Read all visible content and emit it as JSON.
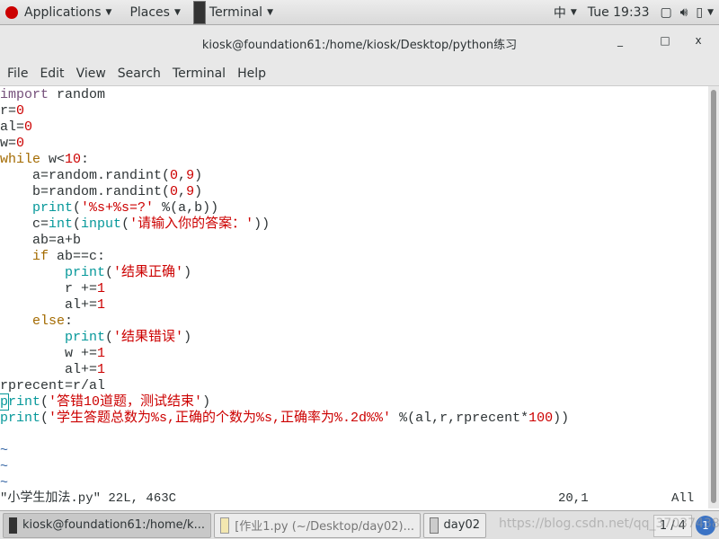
{
  "topbar": {
    "applications": "Applications",
    "places": "Places",
    "terminal": "Terminal",
    "input_method": "中",
    "clock": "Tue 19:33"
  },
  "window": {
    "title": "kiosk@foundation61:/home/kiosk/Desktop/python练习",
    "minimize": "_",
    "maximize": "□",
    "close": "x"
  },
  "menu": [
    "File",
    "Edit",
    "View",
    "Search",
    "Terminal",
    "Help"
  ],
  "code": [
    [
      [
        "import",
        "kw"
      ],
      [
        " random",
        ""
      ]
    ],
    [
      [
        "r=",
        ""
      ],
      [
        "0",
        "num"
      ]
    ],
    [
      [
        "al=",
        ""
      ],
      [
        "0",
        "num"
      ]
    ],
    [
      [
        "w=",
        ""
      ],
      [
        "0",
        "num"
      ]
    ],
    [
      [
        "while",
        "ctl"
      ],
      [
        " w<",
        ""
      ],
      [
        "10",
        "num"
      ],
      [
        ":",
        ""
      ]
    ],
    [
      [
        "    a=random.randint(",
        ""
      ],
      [
        "0",
        "num"
      ],
      [
        ",",
        ""
      ],
      [
        "9",
        "num"
      ],
      [
        ")",
        ""
      ]
    ],
    [
      [
        "    b=random.randint(",
        ""
      ],
      [
        "0",
        "num"
      ],
      [
        ",",
        ""
      ],
      [
        "9",
        "num"
      ],
      [
        ")",
        ""
      ]
    ],
    [
      [
        "    ",
        ""
      ],
      [
        "print",
        "bi"
      ],
      [
        "(",
        ""
      ],
      [
        "'%s+%s=?'",
        "str"
      ],
      [
        " %(a,b))",
        ""
      ]
    ],
    [
      [
        "    c=",
        ""
      ],
      [
        "int",
        "bi"
      ],
      [
        "(",
        ""
      ],
      [
        "input",
        "bi"
      ],
      [
        "(",
        ""
      ],
      [
        "'请输入你的答案：'",
        "str"
      ],
      [
        "))",
        ""
      ]
    ],
    [
      [
        "    ab=a+b",
        ""
      ]
    ],
    [
      [
        "    ",
        ""
      ],
      [
        "if",
        "ctl"
      ],
      [
        " ab==c:",
        ""
      ]
    ],
    [
      [
        "        ",
        ""
      ],
      [
        "print",
        "bi"
      ],
      [
        "(",
        ""
      ],
      [
        "'结果正确'",
        "str"
      ],
      [
        ")",
        ""
      ]
    ],
    [
      [
        "        r +=",
        ""
      ],
      [
        "1",
        "num"
      ]
    ],
    [
      [
        "        al+=",
        ""
      ],
      [
        "1",
        "num"
      ]
    ],
    [
      [
        "    ",
        ""
      ],
      [
        "else",
        "ctl"
      ],
      [
        ":",
        ""
      ]
    ],
    [
      [
        "        ",
        ""
      ],
      [
        "print",
        "bi"
      ],
      [
        "(",
        ""
      ],
      [
        "'结果错误'",
        "str"
      ],
      [
        ")",
        ""
      ]
    ],
    [
      [
        "        w +=",
        ""
      ],
      [
        "1",
        "num"
      ]
    ],
    [
      [
        "        al+=",
        ""
      ],
      [
        "1",
        "num"
      ]
    ],
    [
      [
        "rprecent=r/al",
        ""
      ]
    ],
    [
      [
        "p",
        "bi cursor"
      ],
      [
        "rint",
        "bi"
      ],
      [
        "(",
        ""
      ],
      [
        "'答错10道题，测试结束'",
        "str"
      ],
      [
        ")",
        ""
      ]
    ],
    [
      [
        "print",
        "bi"
      ],
      [
        "(",
        ""
      ],
      [
        "'学生答题总数为%s,正确的个数为%s,正确率为%.2d%%'",
        "str"
      ],
      [
        " %(al,r,rprecent*",
        ""
      ],
      [
        "100",
        "num"
      ],
      [
        "))",
        ""
      ]
    ],
    [
      [
        "",
        ""
      ]
    ],
    [
      [
        "~",
        "tilde"
      ]
    ],
    [
      [
        "~",
        "tilde"
      ]
    ],
    [
      [
        "~",
        "tilde"
      ]
    ]
  ],
  "status": {
    "file": "\"小学生加法.py\" 22L, 463C",
    "position": "20,1",
    "scroll": "All"
  },
  "taskbar": {
    "tasks": [
      "kiosk@foundation61:/home/k...",
      "[作业1.py (~/Desktop/day02)...",
      "day02"
    ],
    "pager": "1 / 4",
    "notifications": "1",
    "watermark": "https://blog.csdn.net/qq_37037438"
  }
}
